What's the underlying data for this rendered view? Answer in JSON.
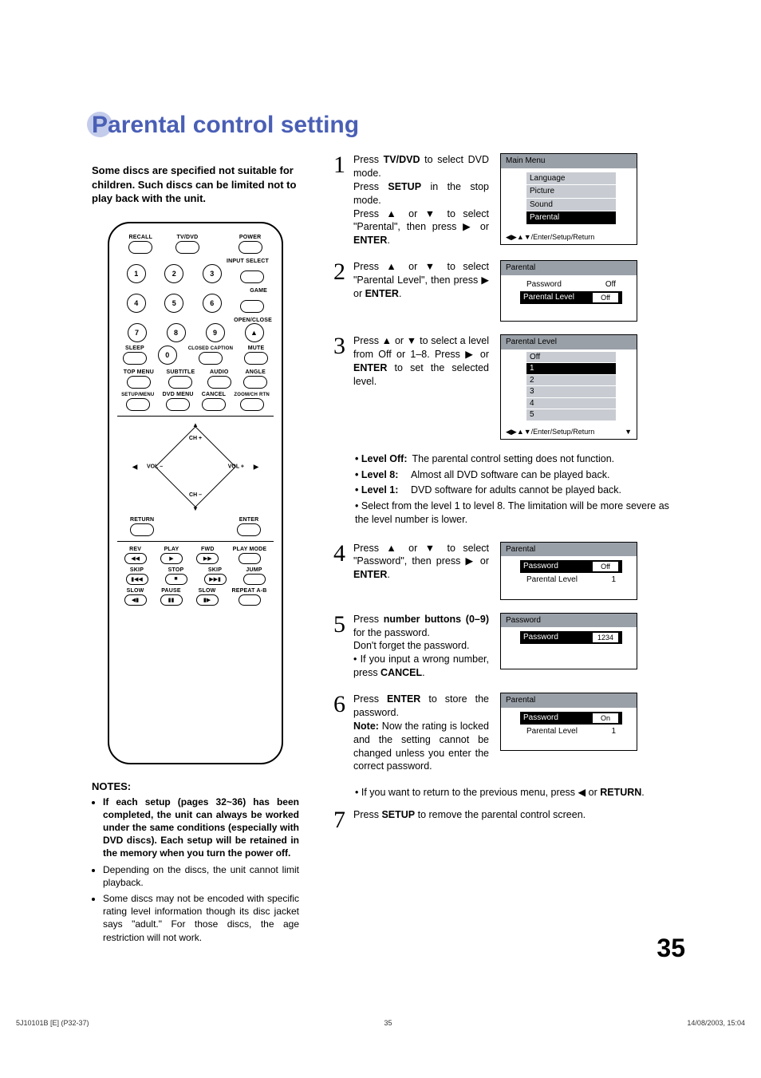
{
  "title": "Parental control setting",
  "intro": "Some discs are specified not suitable for children. Such discs can be limited not to play back with the unit.",
  "remote": {
    "r1": {
      "recall": "RECALL",
      "tvdvd": "TV/DVD",
      "power": "POWER"
    },
    "input_select": "INPUT SELECT",
    "nums": [
      "1",
      "2",
      "3",
      "4",
      "5",
      "6",
      "7",
      "8",
      "9",
      "0"
    ],
    "game": "GAME",
    "openclose": "OPEN/CLOSE",
    "sleep": "SLEEP",
    "cc": "CLOSED CAPTION",
    "mute": "MUTE",
    "topmenu": "TOP MENU",
    "subtitle": "SUBTITLE",
    "audio": "AUDIO",
    "angle": "ANGLE",
    "setupmenu": "SETUP/MENU",
    "dvdmenu": "DVD MENU",
    "cancel": "CANCEL",
    "zoom": "ZOOM/CH RTN",
    "chup": "CH +",
    "chdn": "CH –",
    "voll": "VOL –",
    "volr": "VOL +",
    "return": "RETURN",
    "enter": "ENTER",
    "rev": "REV",
    "play": "PLAY",
    "fwd": "FWD",
    "playmode": "PLAY MODE",
    "skipb": "SKIP",
    "stop": "STOP",
    "skipf": "SKIP",
    "jump": "JUMP",
    "slowb": "SLOW",
    "pause": "PAUSE",
    "slowf": "SLOW",
    "repeat": "REPEAT A-B"
  },
  "notes_head": "NOTES:",
  "notes": [
    "If each setup (pages 32~36) has been completed, the unit can always be worked under the same conditions (especially with DVD discs). Each setup will be retained in the memory when you turn the power off.",
    "Depending on the discs, the unit cannot limit playback.",
    "Some discs may not be encoded with specific rating level information though its disc jacket says \"adult.\" For those discs, the age restriction will not work."
  ],
  "steps": {
    "s1": {
      "n": "1",
      "a": "Press ",
      "b": "TV/DVD",
      "c": " to select DVD mode.",
      "d": "Press ",
      "e": "SETUP",
      "f": " in the stop mode.",
      "g": "Press ▲ or ▼ to select \"Parental\", then press ▶ or ",
      "h": "ENTER",
      "i": "."
    },
    "s2": {
      "n": "2",
      "a": "Press ▲ or ▼ to select \"Parental Level\", then press ▶ or ",
      "b": "ENTER",
      "c": "."
    },
    "s3": {
      "n": "3",
      "a": "Press ▲ or ▼ to select a level from Off or 1–8. Press ▶ or ",
      "b": "ENTER",
      "c": " to set the selected level."
    },
    "s4": {
      "n": "4",
      "a": "Press ▲ or ▼ to select \"Password\", then press ▶ or ",
      "b": "ENTER",
      "c": "."
    },
    "s5": {
      "n": "5",
      "a": "Press ",
      "b": "number buttons (0–9)",
      "c": " for the password.",
      "d": "Don't forget the password.",
      "e": "If you input a wrong number, press ",
      "f": "CANCEL",
      "g": "."
    },
    "s6": {
      "n": "6",
      "a": "Press ",
      "b": "ENTER",
      "c": " to store the password.",
      "d": "Note:",
      "e": " Now the rating is locked and the setting cannot be changed unless you enter the correct password."
    },
    "s6b": {
      "a": "If you want to return to the previous menu, press ◀ or ",
      "b": "RETURN",
      "c": "."
    },
    "s7": {
      "n": "7",
      "a": "Press ",
      "b": "SETUP",
      "c": " to remove the parental control screen."
    }
  },
  "levels": {
    "off_l": "Level Off:",
    "off_d": "The parental control setting does not function.",
    "l8_l": "Level 8:",
    "l8_d": "Almost all DVD software can be played back.",
    "l1_l": "Level 1:",
    "l1_d": "DVD software for adults cannot be played back.",
    "sel": "Select from the level 1 to level 8. The limitation will be more severe as the level number is lower."
  },
  "osd1": {
    "title": "Main Menu",
    "i1": "Language",
    "i2": "Picture",
    "i3": "Sound",
    "i4": "Parental",
    "hint": "◀▶▲▼/Enter/Setup/Return"
  },
  "osd2": {
    "title": "Parental",
    "r1": "Password",
    "v1": "Off",
    "r2": "Parental Level",
    "v2": "Off"
  },
  "osd3": {
    "title": "Parental Level",
    "off": "Off",
    "l1": "1",
    "l2": "2",
    "l3": "3",
    "l4": "4",
    "l5": "5",
    "hint": "◀▶▲▼/Enter/Setup/Return"
  },
  "osd4": {
    "title": "Parental",
    "r1": "Password",
    "v1": "Off",
    "r2": "Parental Level",
    "v2": "1"
  },
  "osd5": {
    "title": "Password",
    "r1": "Password",
    "v1": "1234"
  },
  "osd6": {
    "title": "Parental",
    "r1": "Password",
    "v1": "On",
    "r2": "Parental Level",
    "v2": "1"
  },
  "pagenum": "35",
  "footer": {
    "left": "5J10101B [E] (P32-37)",
    "mid": "35",
    "right": "14/08/2003, 15:04"
  }
}
